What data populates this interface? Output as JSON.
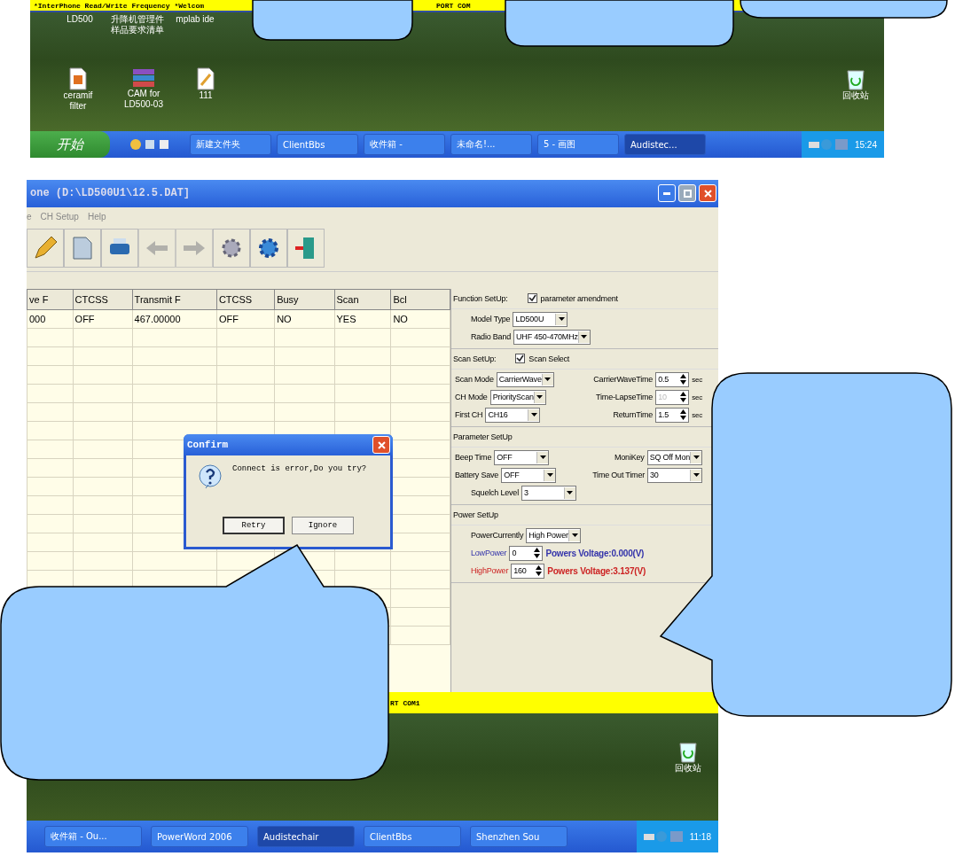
{
  "top_screenshot": {
    "status_bar": {
      "left": "*InterPhone Read/Write Frequency *Welcom",
      "right": "PORT COM"
    },
    "desktop_icons": [
      {
        "lines": [
          "LD500"
        ],
        "kind": "none"
      },
      {
        "lines": [
          "升降机管理件",
          "样品要求清单"
        ],
        "kind": "none"
      },
      {
        "lines": [
          "mplab ide"
        ],
        "kind": "none"
      },
      {
        "lines": [
          "ceramif",
          "filter"
        ],
        "kind": "doc"
      },
      {
        "lines": [
          "CAM for",
          "LD500-03"
        ],
        "kind": "archive"
      },
      {
        "lines": [
          "111"
        ],
        "kind": "paint"
      },
      {
        "lines": [
          "回收站"
        ],
        "kind": "bin"
      }
    ],
    "taskbar": {
      "start": "开始",
      "tasks": [
        {
          "label": "新建文件夹",
          "selected": false
        },
        {
          "label": "ClientBbs",
          "selected": false
        },
        {
          "label": "收件箱 -",
          "selected": false
        },
        {
          "label": "未命名!...",
          "selected": false
        },
        {
          "label": "5 - 画图",
          "selected": false
        },
        {
          "label": "Audistec...",
          "selected": true
        }
      ],
      "clock": "15:24"
    }
  },
  "main_window": {
    "title": "one (D:\\LD500U1\\12.5.DAT]",
    "menu": [
      "e",
      "CH Setup",
      "Help"
    ],
    "toolbar": [
      {
        "disabled": false
      },
      {
        "disabled": false
      },
      {
        "disabled": false
      },
      {
        "disabled": true
      },
      {
        "disabled": true
      },
      {
        "disabled": false
      },
      {
        "disabled": false
      },
      {
        "disabled": false
      }
    ],
    "table": {
      "columns": [
        "ve F",
        "CTCSS",
        "Transmit F",
        "CTCSS",
        "Busy",
        "Scan",
        "Bcl"
      ],
      "rows": [
        [
          "000",
          "OFF",
          "467.00000",
          "OFF",
          "NO",
          "YES",
          "NO"
        ]
      ]
    },
    "panel": {
      "sections": [
        {
          "title": "Function SetUp:",
          "check": {
            "label": "parameter amendment",
            "checked": true
          },
          "rows": [
            [
              {
                "label": "Model Type",
                "value": "LD500U",
                "kind": "select"
              }
            ],
            [
              {
                "label": "Radio Band",
                "value": "UHF 450-470MHz",
                "kind": "select"
              }
            ]
          ]
        },
        {
          "title": "Scan SetUp:",
          "check": {
            "label": "Scan Select",
            "checked": true
          },
          "rows": [
            [
              {
                "label": "Scan Mode",
                "value": "CarrierWave",
                "kind": "select"
              },
              {
                "label": "CarrierWaveTime",
                "value": "0.5",
                "kind": "spin",
                "unit": "sec",
                "disabled": false
              }
            ],
            [
              {
                "label": "CH Mode",
                "value": "PriorityScan",
                "kind": "select"
              },
              {
                "label": "Time-LapseTime",
                "value": "10",
                "kind": "spin",
                "unit": "sec",
                "disabled": true
              }
            ],
            [
              {
                "label": "First CH",
                "value": "CH16",
                "kind": "select"
              },
              {
                "label": "ReturnTime",
                "value": "1.5",
                "kind": "spin",
                "unit": "sec",
                "disabled": false
              }
            ]
          ]
        },
        {
          "title": "Parameter SetUp",
          "rows": [
            [
              {
                "label": "Beep Time",
                "value": "OFF",
                "kind": "select"
              },
              {
                "label": "MoniKey",
                "value": "SQ Off Mon",
                "kind": "select"
              }
            ],
            [
              {
                "label": "Battery Save",
                "value": "OFF",
                "kind": "select"
              },
              {
                "label": "Time Out Timer",
                "value": "30",
                "kind": "select"
              }
            ],
            [
              {
                "label": "Squelch Level",
                "value": "3",
                "kind": "select"
              }
            ]
          ]
        },
        {
          "title": "Power SetUp",
          "rows": [
            [
              {
                "label": "PowerCurrently",
                "value": "High Power",
                "kind": "select"
              }
            ],
            [
              {
                "label": "LowPower",
                "value": "0",
                "kind": "power",
                "reading": "Powers Voltage:0.000(V)",
                "color": "#3333aa"
              }
            ],
            [
              {
                "label": "HighPower",
                "value": "160",
                "kind": "power",
                "reading": "Powers Voltage:3.137(V)",
                "color": "#cc2222"
              }
            ]
          ]
        }
      ]
    },
    "status_bar": "RT COM1"
  },
  "dialog": {
    "title": "Confirm",
    "message": "Connect is error,Do you try?",
    "buttons": [
      {
        "label": "Retry",
        "selected": true
      },
      {
        "label": "Ignore",
        "selected": false
      }
    ]
  },
  "bottom_desktop": {
    "icons": [
      {
        "label": "回收站",
        "kind": "bin"
      }
    ],
    "taskbar": {
      "tasks": [
        {
          "label": "收件箱 - Ou...",
          "selected": false
        },
        {
          "label": "PowerWord 2006",
          "selected": false
        },
        {
          "label": "Audistechair",
          "selected": true
        },
        {
          "label": "ClientBbs",
          "selected": false
        },
        {
          "label": "Shenzhen Sou",
          "selected": false
        }
      ],
      "clock": "11:18"
    }
  }
}
